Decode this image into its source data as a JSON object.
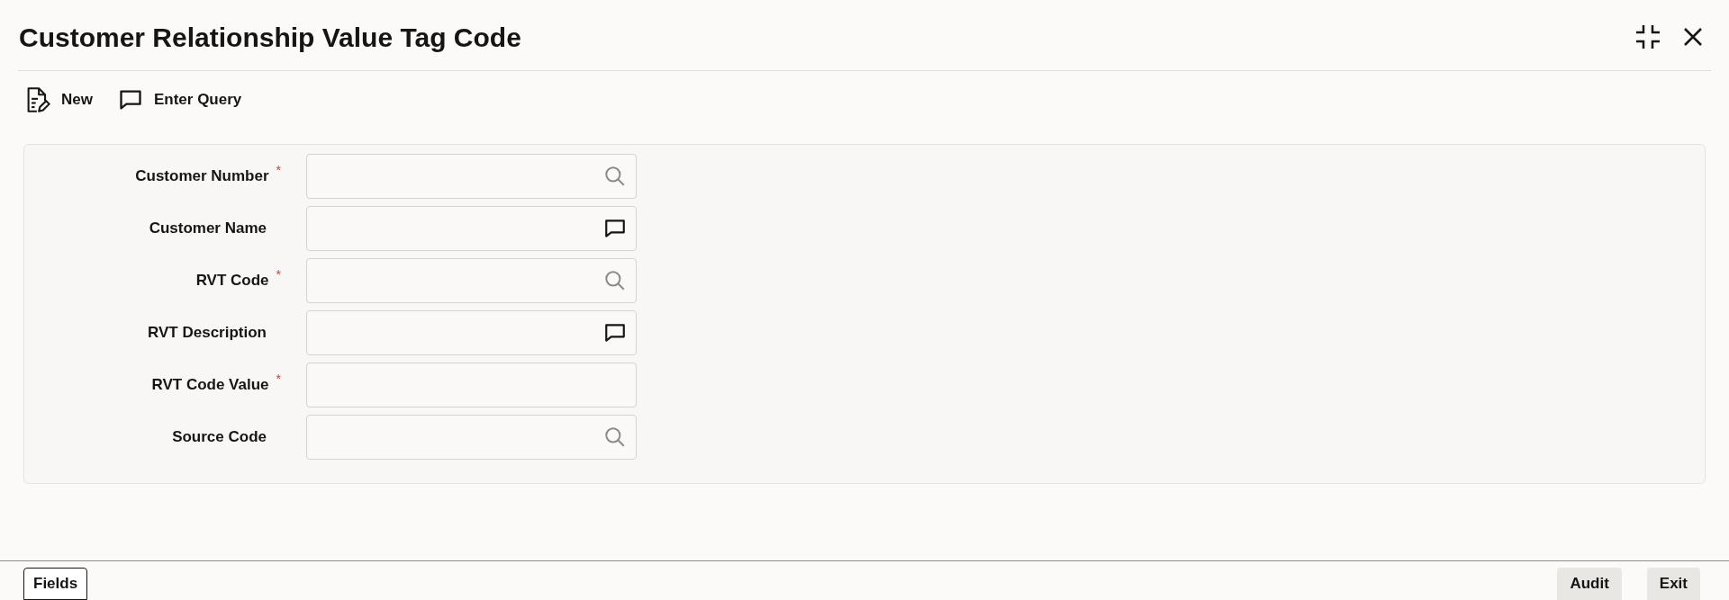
{
  "window": {
    "title": "Customer Relationship Value Tag Code"
  },
  "toolbar": [
    {
      "label": "New",
      "kind": "new"
    },
    {
      "label": "Enter Query",
      "kind": "query"
    }
  ],
  "fields": [
    {
      "label": "Customer Number",
      "required": true,
      "kind": "lookup"
    },
    {
      "label": "Customer Name",
      "required": false,
      "kind": "comment"
    },
    {
      "label": "RVT Code",
      "required": true,
      "kind": "lookup"
    },
    {
      "label": "RVT Description",
      "required": false,
      "kind": "comment"
    },
    {
      "label": "RVT Code Value",
      "required": true,
      "kind": "plain"
    },
    {
      "label": "Source Code",
      "required": false,
      "kind": "lookup"
    }
  ],
  "required_marker": "*",
  "footer": {
    "left": [
      "Fields"
    ],
    "right": [
      "Audit",
      "Exit"
    ]
  }
}
